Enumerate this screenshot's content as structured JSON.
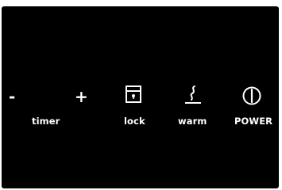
{
  "panel": {
    "background": "#000000",
    "foreground": "#ffffff"
  },
  "timer": {
    "minus_label": "-",
    "plus_label": "+",
    "label": "timer"
  },
  "lock": {
    "icon": "lock-icon",
    "label": "lock"
  },
  "warm": {
    "icon": "warm-steam-icon",
    "label": "warm"
  },
  "power": {
    "icon": "power-icon",
    "label": "POWER"
  }
}
